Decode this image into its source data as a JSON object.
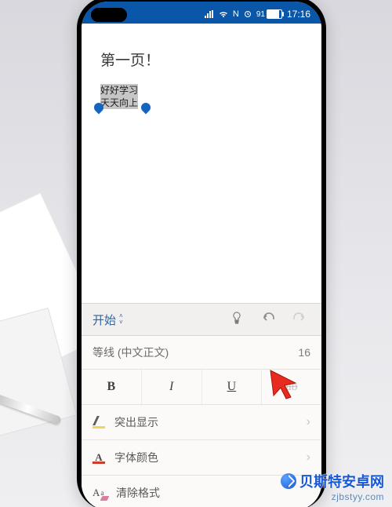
{
  "status": {
    "battery_text": "91",
    "time": "17:16",
    "nfc": "N"
  },
  "document": {
    "title": "第一页！",
    "selected_line1": "好好学习",
    "selected_line2": "天天向上"
  },
  "panel": {
    "begin_label": "开始",
    "font_name": "等线 (中文正文)",
    "font_size": "16",
    "bold": "B",
    "italic": "I",
    "underline": "U",
    "strike": "ab"
  },
  "options": {
    "highlight": "突出显示",
    "font_color": "字体颜色",
    "clear_format": "清除格式"
  },
  "watermark": {
    "line1": "贝斯特安卓网",
    "line2": "zjbstyy.com"
  }
}
